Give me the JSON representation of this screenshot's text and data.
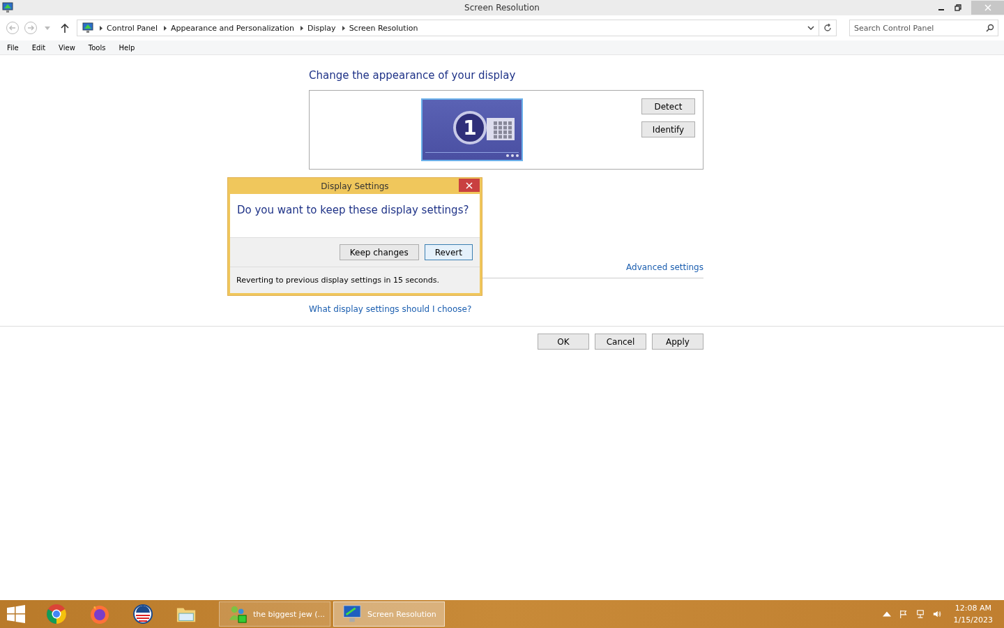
{
  "window": {
    "title": "Screen Resolution"
  },
  "address_bar": {
    "breadcrumbs": [
      "Control Panel",
      "Appearance and Personalization",
      "Display",
      "Screen Resolution"
    ]
  },
  "search": {
    "placeholder": "Search Control Panel"
  },
  "menu": [
    "File",
    "Edit",
    "View",
    "Tools",
    "Help"
  ],
  "heading": "Change the appearance of your display",
  "monitor": {
    "number": "1"
  },
  "side_buttons": [
    "Detect",
    "Identify"
  ],
  "advanced_link": "Advanced settings",
  "help_link": "What display settings should I choose?",
  "buttons": [
    "OK",
    "Cancel",
    "Apply"
  ],
  "dialog": {
    "title": "Display Settings",
    "question": "Do you want to keep these display settings?",
    "buttons": [
      {
        "label": "Keep changes",
        "selected": false
      },
      {
        "label": "Revert",
        "selected": true
      }
    ],
    "countdown": "Reverting to previous display settings in 15 seconds."
  },
  "taskbar": {
    "windows": [
      {
        "label": "the biggest jew (...",
        "kind": "people",
        "selected": false
      },
      {
        "label": "Screen Resolution",
        "kind": "display",
        "selected": true
      }
    ],
    "clock": {
      "time": "12:08 AM",
      "date": "1/15/2023"
    }
  }
}
